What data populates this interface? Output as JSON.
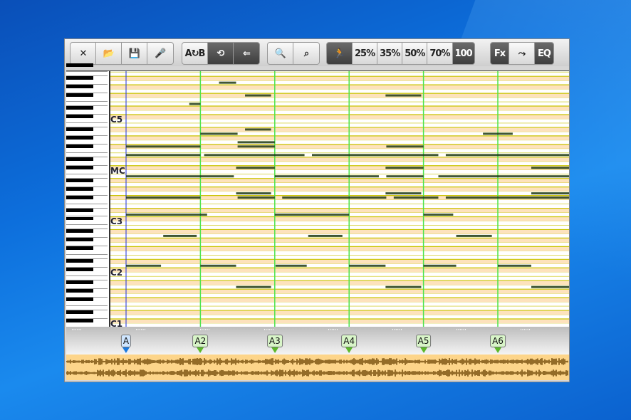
{
  "toolbar": {
    "groups": [
      [
        {
          "name": "close",
          "icon": "close-icon",
          "label": "✕"
        },
        {
          "name": "open",
          "icon": "folder-open-icon",
          "label": "📂"
        },
        {
          "name": "save",
          "icon": "floppy-disk-icon",
          "label": "💾"
        },
        {
          "name": "microphone",
          "icon": "microphone-icon",
          "label": "🎤"
        }
      ],
      [
        {
          "name": "ab-swap",
          "icon": "ab-swap-icon",
          "label": "A↻B"
        },
        {
          "name": "loop",
          "icon": "loop-icon",
          "label": "⟲",
          "dark": true
        },
        {
          "name": "jump-start",
          "icon": "arrow-left-bars-icon",
          "label": "⇐",
          "dark": true
        }
      ],
      [
        {
          "name": "zoom-page",
          "icon": "document-search-icon",
          "label": "🔍"
        },
        {
          "name": "zoom-out",
          "icon": "magnifier-icon",
          "label": "⌕"
        }
      ],
      [
        {
          "name": "speed",
          "icon": "running-man-icon",
          "label": "🏃",
          "dark": true
        },
        {
          "name": "speed-25",
          "label": "25%"
        },
        {
          "name": "speed-35",
          "label": "35%"
        },
        {
          "name": "speed-50",
          "label": "50%"
        },
        {
          "name": "speed-70",
          "label": "70%"
        },
        {
          "name": "speed-100",
          "label": "100",
          "dark": true
        }
      ],
      [
        {
          "name": "fx",
          "label": "Fx",
          "dark": true
        },
        {
          "name": "route",
          "icon": "route-arrow-icon",
          "label": "⤳"
        },
        {
          "name": "eq",
          "label": "EQ",
          "dark": true
        }
      ]
    ]
  },
  "octave_labels": [
    {
      "label": "C5",
      "pitch": 48
    },
    {
      "label": "MC",
      "pitch": 36
    },
    {
      "label": "C3",
      "pitch": 24
    },
    {
      "label": "C2",
      "pitch": 12
    },
    {
      "label": "C1",
      "pitch": 0
    }
  ],
  "markers": [
    {
      "label": "A",
      "pos": 0,
      "current": true
    },
    {
      "label": "A2",
      "pos": 1
    },
    {
      "label": "A3",
      "pos": 2
    },
    {
      "label": "A4",
      "pos": 3
    },
    {
      "label": "A5",
      "pos": 4
    },
    {
      "label": "A6",
      "pos": 5
    }
  ],
  "colors": {
    "black_row": "#fde2bd",
    "row_line": "#c8c400",
    "marker_line": "#4de34d",
    "playhead": "#1a2ee0",
    "note": "#1e3a10"
  },
  "notes": [
    [
      14,
      0,
      0.47
    ],
    [
      14,
      1,
      1.48
    ],
    [
      14,
      2.01,
      2.43
    ],
    [
      14,
      3,
      3.49
    ],
    [
      14,
      4,
      4.44
    ],
    [
      14,
      5,
      5.45
    ],
    [
      9,
      1.48,
      1.95
    ],
    [
      9,
      3.49,
      3.97
    ],
    [
      9,
      5.45,
      5.96
    ],
    [
      21,
      0.5,
      0.95
    ],
    [
      21,
      2.45,
      2.91
    ],
    [
      21,
      4.44,
      4.92
    ],
    [
      26,
      0,
      1.09
    ],
    [
      26,
      2,
      3
    ],
    [
      26,
      4,
      4.4
    ],
    [
      30,
      0,
      1
    ],
    [
      30,
      1.5,
      2
    ],
    [
      30,
      2.1,
      3.5
    ],
    [
      30,
      3.6,
      4.2
    ],
    [
      30,
      4.3,
      5.96
    ],
    [
      31,
      1.48,
      1.95
    ],
    [
      31,
      3.49,
      3.97
    ],
    [
      31,
      5.45,
      5.96
    ],
    [
      35,
      0,
      1.45
    ],
    [
      35,
      2,
      3.4
    ],
    [
      35,
      3.5,
      4
    ],
    [
      35,
      4.2,
      5.96
    ],
    [
      37,
      1.48,
      2
    ],
    [
      37,
      3.49,
      4
    ],
    [
      37,
      5.45,
      5.96
    ],
    [
      40,
      0,
      1
    ],
    [
      40,
      1.05,
      2.4
    ],
    [
      40,
      2.5,
      4.2
    ],
    [
      40,
      4.3,
      5.96
    ],
    [
      42,
      0,
      1
    ],
    [
      42,
      1.5,
      2
    ],
    [
      42,
      3.5,
      4
    ],
    [
      43,
      1.5,
      2
    ],
    [
      45,
      1,
      1.5
    ],
    [
      45,
      4.8,
      5.2
    ],
    [
      46,
      1.6,
      1.95
    ],
    [
      52,
      0.85,
      1
    ],
    [
      54,
      1.6,
      1.95
    ],
    [
      54,
      3.49,
      3.97
    ],
    [
      57,
      1.25,
      1.48
    ]
  ]
}
